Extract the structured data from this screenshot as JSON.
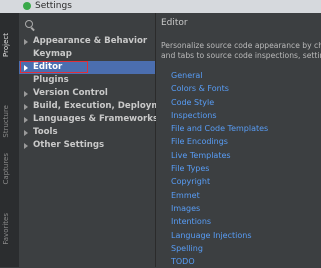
{
  "window": {
    "title": "Settings"
  },
  "sidebar_tabs": [
    "Project",
    "Structure",
    "Captures",
    "Favorites"
  ],
  "tree": [
    {
      "label": "Appearance & Behavior",
      "expandable": true,
      "selected": false
    },
    {
      "label": "Keymap",
      "expandable": false,
      "selected": false
    },
    {
      "label": "Editor",
      "expandable": true,
      "selected": true
    },
    {
      "label": "Plugins",
      "expandable": false,
      "selected": false
    },
    {
      "label": "Version Control",
      "expandable": true,
      "selected": false
    },
    {
      "label": "Build, Execution, Deployment",
      "expandable": true,
      "selected": false
    },
    {
      "label": "Languages & Frameworks",
      "expandable": true,
      "selected": false
    },
    {
      "label": "Tools",
      "expandable": true,
      "selected": false
    },
    {
      "label": "Other Settings",
      "expandable": true,
      "selected": false
    }
  ],
  "editor": {
    "title": "Editor",
    "description_line1": "Personalize source code appearance by ch",
    "description_line2": "and tabs to source code inspections, settin",
    "links": [
      "General",
      "Colors & Fonts",
      "Code Style",
      "Inspections",
      "File and Code Templates",
      "File Encodings",
      "Live Templates",
      "File Types",
      "Copyright",
      "Emmet",
      "Images",
      "Intentions",
      "Language Injections",
      "Spelling",
      "TODO"
    ]
  },
  "colors": {
    "selection": "#4b6eaf",
    "link": "#589df6",
    "highlight_border": "#e0303a"
  }
}
